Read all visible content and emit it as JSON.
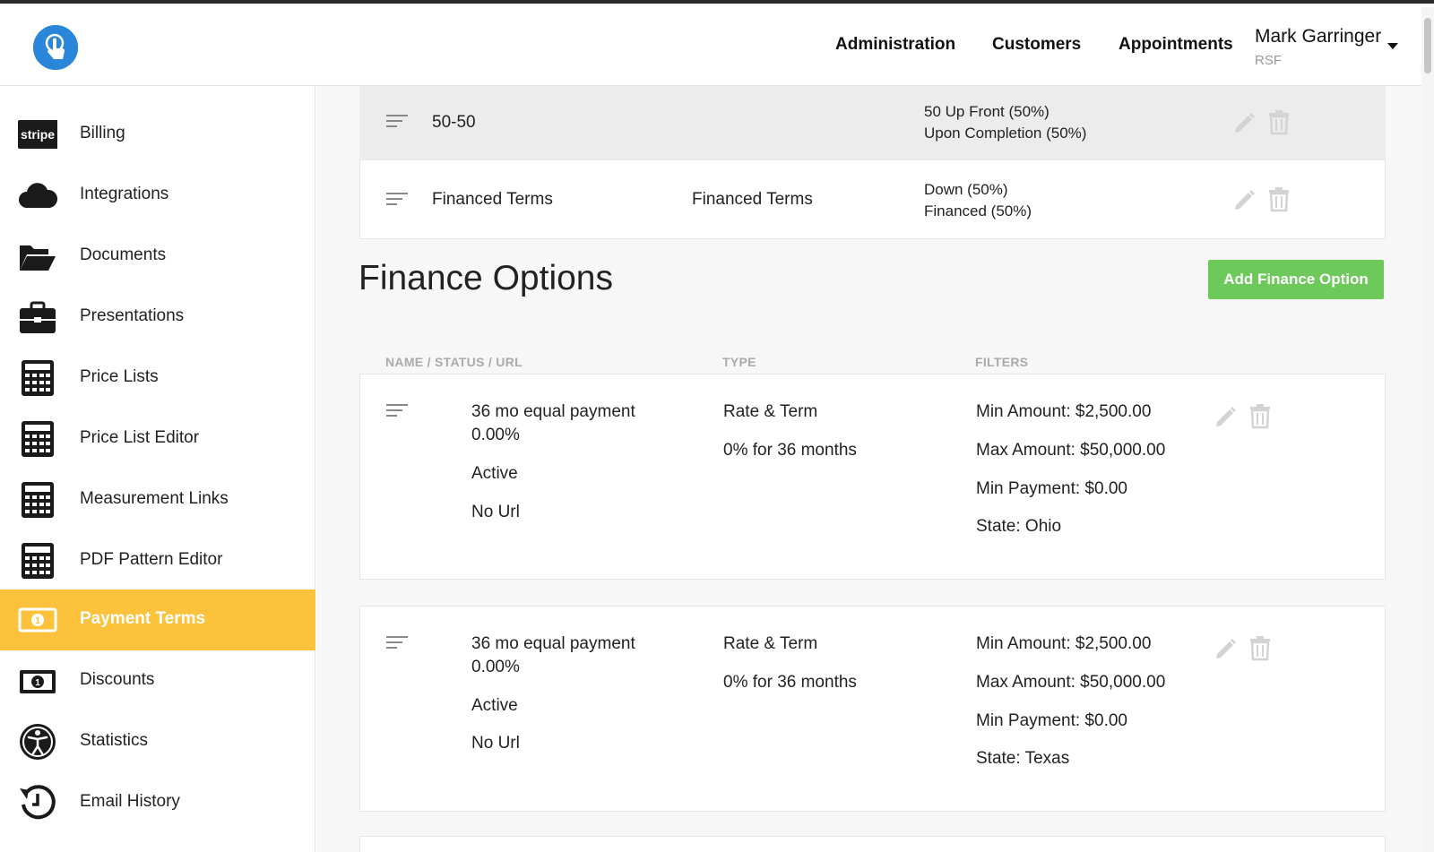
{
  "header": {
    "nav": [
      "Administration",
      "Customers",
      "Appointments"
    ],
    "user_name": "Mark Garringer",
    "user_sub": "RSF"
  },
  "sidebar": {
    "items": [
      {
        "label": "Billing",
        "icon": "stripe-icon"
      },
      {
        "label": "Integrations",
        "icon": "cloud-icon"
      },
      {
        "label": "Documents",
        "icon": "folder-open-icon"
      },
      {
        "label": "Presentations",
        "icon": "briefcase-icon"
      },
      {
        "label": "Price Lists",
        "icon": "calculator-icon"
      },
      {
        "label": "Price List Editor",
        "icon": "calculator-icon"
      },
      {
        "label": "Measurement Links",
        "icon": "calculator-icon"
      },
      {
        "label": "PDF Pattern Editor",
        "icon": "calculator-icon"
      },
      {
        "label": "Payment Terms",
        "icon": "money-icon",
        "active": true
      },
      {
        "label": "Discounts",
        "icon": "money-icon"
      },
      {
        "label": "Statistics",
        "icon": "accessibility-icon"
      },
      {
        "label": "Email History",
        "icon": "history-icon"
      }
    ],
    "stripe_text": "stripe"
  },
  "payment_terms": [
    {
      "name": "50-50",
      "type": "",
      "lines": [
        "50 Up Front (50%)",
        "Upon Completion (50%)"
      ]
    },
    {
      "name": "Financed Terms",
      "type": "Financed Terms",
      "lines": [
        "Down (50%)",
        "Financed (50%)"
      ]
    }
  ],
  "finance": {
    "title": "Finance Options",
    "add_button": "Add Finance Option",
    "columns": [
      "NAME / STATUS / URL",
      "TYPE",
      "FILTERS"
    ],
    "options": [
      {
        "name": "36 mo equal payment",
        "rate": "0.00%",
        "status": "Active",
        "url": "No Url",
        "type": "Rate & Term",
        "type_detail": "0% for 36 months",
        "filters": [
          "Min Amount: $2,500.00",
          "Max Amount: $50,000.00",
          "Min Payment: $0.00",
          "State: Ohio"
        ]
      },
      {
        "name": "36 mo equal payment",
        "rate": "0.00%",
        "status": "Active",
        "url": "No Url",
        "type": "Rate & Term",
        "type_detail": "0% for 36 months",
        "filters": [
          "Min Amount: $2,500.00",
          "Max Amount: $50,000.00",
          "Min Payment: $0.00",
          "State: Texas"
        ]
      }
    ]
  },
  "colors": {
    "accent": "#fcc23b",
    "add_button": "#6cc95a",
    "logo": "#2a86d8"
  }
}
